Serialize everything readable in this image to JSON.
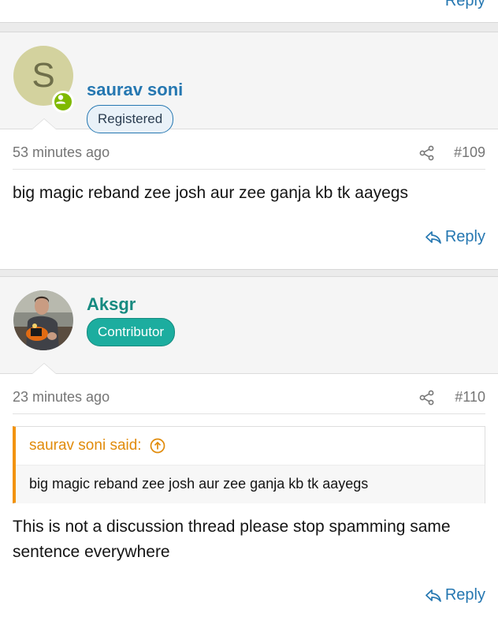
{
  "previous_post": {
    "reply_label": "Reply"
  },
  "posts": [
    {
      "username": "saurav soni",
      "avatar_letter": "S",
      "badge": "Registered",
      "timestamp": "53 minutes ago",
      "post_number": "#109",
      "body": "big magic reband zee josh aur zee ganja kb tk aayegs",
      "reply_label": "Reply",
      "colors": {
        "username": "#2577b1",
        "avatar_bg": "#d3d29e",
        "online": "#7fb900"
      }
    },
    {
      "username": "Aksgr",
      "badge": "Contributor",
      "timestamp": "23 minutes ago",
      "post_number": "#110",
      "quote": {
        "author_line": "saurav soni said:",
        "text": "big magic reband zee josh aur zee ganja kb tk aayegs"
      },
      "body": "This is not a discussion thread please stop spamming same sentence everywhere",
      "reply_label": "Reply",
      "colors": {
        "username": "#168a80",
        "badge": "#1cad9f",
        "quote_accent": "#f2930d"
      }
    }
  ],
  "icons": {
    "share": "share-icon",
    "reply": "reply-arrow-icon",
    "quote_jump": "arrow-up-circle-icon",
    "online": "online-status-icon"
  }
}
